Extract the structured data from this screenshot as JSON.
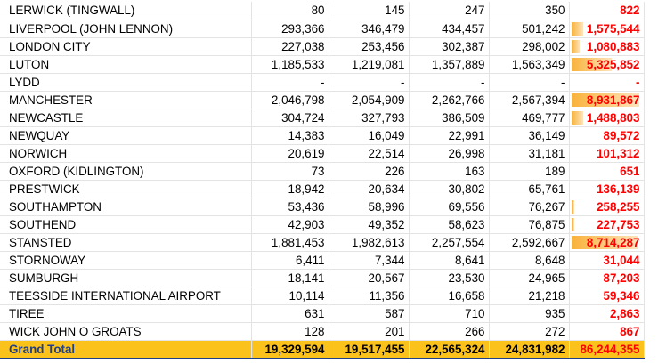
{
  "colors": {
    "total_text": "#ff0000",
    "grand_fill": "#fcc21c",
    "grand_label": "#1f3f8a",
    "databar": "#f9b23a"
  },
  "rows": [
    {
      "name": "LERWICK (TINGWALL)",
      "c1": "80",
      "c2": "145",
      "c3": "247",
      "c4": "350",
      "total": "822",
      "bar": 0
    },
    {
      "name": "LIVERPOOL (JOHN LENNON)",
      "c1": "293,366",
      "c2": "346,479",
      "c3": "434,457",
      "c4": "501,242",
      "total": "1,575,544",
      "bar": 1575544
    },
    {
      "name": "LONDON CITY",
      "c1": "227,038",
      "c2": "253,456",
      "c3": "302,387",
      "c4": "298,002",
      "total": "1,080,883",
      "bar": 1080883
    },
    {
      "name": "LUTON",
      "c1": "1,185,533",
      "c2": "1,219,081",
      "c3": "1,357,889",
      "c4": "1,563,349",
      "total": "5,325,852",
      "bar": 5325852
    },
    {
      "name": "LYDD",
      "c1": "-",
      "c2": "-",
      "c3": "-",
      "c4": "-",
      "total": "-",
      "bar": 0
    },
    {
      "name": "MANCHESTER",
      "c1": "2,046,798",
      "c2": "2,054,909",
      "c3": "2,262,766",
      "c4": "2,567,394",
      "total": "8,931,867",
      "bar": 8931867
    },
    {
      "name": "NEWCASTLE",
      "c1": "304,724",
      "c2": "327,793",
      "c3": "386,509",
      "c4": "469,777",
      "total": "1,488,803",
      "bar": 1488803
    },
    {
      "name": "NEWQUAY",
      "c1": "14,383",
      "c2": "16,049",
      "c3": "22,991",
      "c4": "36,149",
      "total": "89,572",
      "bar": 0
    },
    {
      "name": "NORWICH",
      "c1": "20,619",
      "c2": "22,514",
      "c3": "26,998",
      "c4": "31,181",
      "total": "101,312",
      "bar": 0
    },
    {
      "name": "OXFORD (KIDLINGTON)",
      "c1": "73",
      "c2": "226",
      "c3": "163",
      "c4": "189",
      "total": "651",
      "bar": 0
    },
    {
      "name": "PRESTWICK",
      "c1": "18,942",
      "c2": "20,634",
      "c3": "30,802",
      "c4": "65,761",
      "total": "136,139",
      "bar": 0
    },
    {
      "name": "SOUTHAMPTON",
      "c1": "53,436",
      "c2": "58,996",
      "c3": "69,556",
      "c4": "76,267",
      "total": "258,255",
      "bar": 258255
    },
    {
      "name": "SOUTHEND",
      "c1": "42,903",
      "c2": "49,352",
      "c3": "58,623",
      "c4": "76,875",
      "total": "227,753",
      "bar": 227753
    },
    {
      "name": "STANSTED",
      "c1": "1,881,453",
      "c2": "1,982,613",
      "c3": "2,257,554",
      "c4": "2,592,667",
      "total": "8,714,287",
      "bar": 8714287
    },
    {
      "name": "STORNOWAY",
      "c1": "6,411",
      "c2": "7,344",
      "c3": "8,641",
      "c4": "8,648",
      "total": "31,044",
      "bar": 0
    },
    {
      "name": "SUMBURGH",
      "c1": "18,141",
      "c2": "20,567",
      "c3": "23,530",
      "c4": "24,965",
      "total": "87,203",
      "bar": 0
    },
    {
      "name": "TEESSIDE INTERNATIONAL AIRPORT",
      "c1": "10,114",
      "c2": "11,356",
      "c3": "16,658",
      "c4": "21,218",
      "total": "59,346",
      "bar": 0
    },
    {
      "name": "TIREE",
      "c1": "631",
      "c2": "587",
      "c3": "710",
      "c4": "935",
      "total": "2,863",
      "bar": 0
    },
    {
      "name": "WICK JOHN O GROATS",
      "c1": "128",
      "c2": "201",
      "c3": "266",
      "c4": "272",
      "total": "867",
      "bar": 0
    }
  ],
  "grand": {
    "name": "Grand Total",
    "c1": "19,329,594",
    "c2": "19,517,455",
    "c3": "22,565,324",
    "c4": "24,831,982",
    "total": "86,244,355"
  },
  "bar_max": 8931867
}
